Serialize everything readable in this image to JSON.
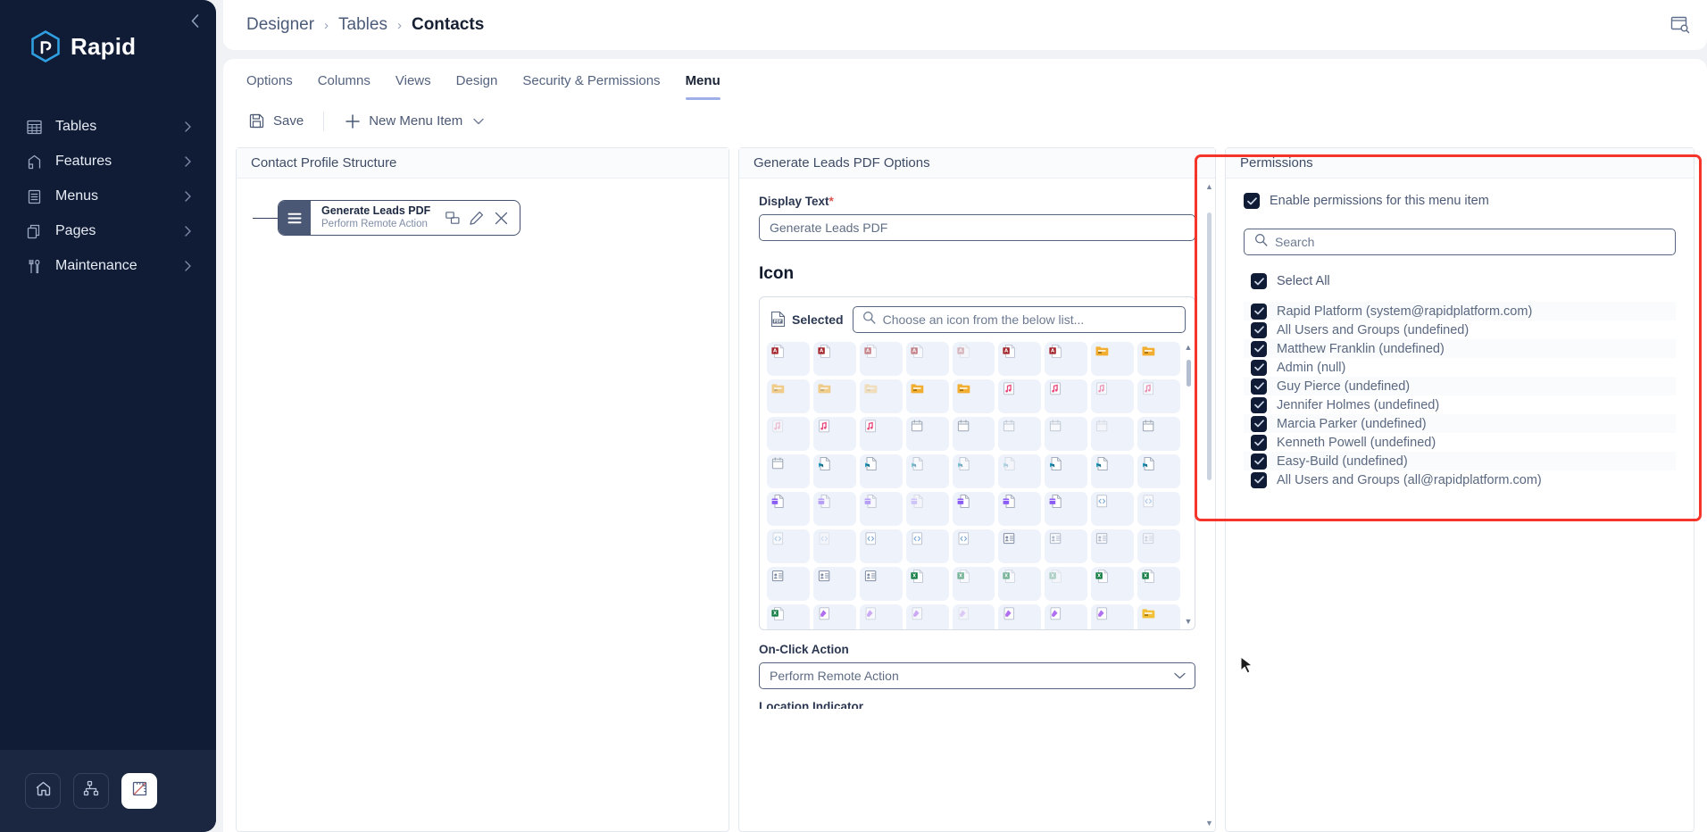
{
  "brand": {
    "name": "Rapid",
    "collapse_icon": "chevron-left-icon"
  },
  "sidebar": {
    "items": [
      {
        "label": "Tables",
        "icon": "table-icon"
      },
      {
        "label": "Features",
        "icon": "features-icon"
      },
      {
        "label": "Menus",
        "icon": "menu-list-icon"
      },
      {
        "label": "Pages",
        "icon": "pages-icon"
      },
      {
        "label": "Maintenance",
        "icon": "tools-icon"
      }
    ],
    "footer_buttons": [
      {
        "name": "home-button",
        "icon": "home-icon",
        "active": false
      },
      {
        "name": "workflow-button",
        "icon": "sitemap-icon",
        "active": false
      },
      {
        "name": "designer-button",
        "icon": "ruler-icon",
        "active": true
      }
    ]
  },
  "topbar": {
    "breadcrumb": [
      {
        "label": "Designer",
        "active": false
      },
      {
        "label": "Tables",
        "active": false
      },
      {
        "label": "Contacts",
        "active": true
      }
    ],
    "separator": "›",
    "right_icon": "window-search-icon"
  },
  "tabs": [
    {
      "label": "Options",
      "active": false
    },
    {
      "label": "Columns",
      "active": false
    },
    {
      "label": "Views",
      "active": false
    },
    {
      "label": "Design",
      "active": false
    },
    {
      "label": "Security & Permissions",
      "active": false
    },
    {
      "label": "Menu",
      "active": true
    }
  ],
  "toolbar": {
    "save_label": "Save",
    "save_icon": "save-disk-icon",
    "new_menu_item_label": "New Menu Item",
    "new_menu_item_icon": "plus-icon",
    "new_menu_item_chevron": "chevron-down-icon"
  },
  "structure": {
    "title": "Contact Profile Structure",
    "card": {
      "title": "Generate Leads PDF",
      "subtitle": "Perform Remote Action",
      "grip_icon": "hamburger-grip-icon",
      "actions": [
        {
          "name": "duplicate-icon",
          "glyph": "copy"
        },
        {
          "name": "edit-pencil-icon",
          "glyph": "pencil"
        },
        {
          "name": "delete-close-icon",
          "glyph": "close"
        }
      ]
    }
  },
  "options": {
    "title": "Generate Leads PDF Options",
    "display_text": {
      "label": "Display Text",
      "required_marker": "*",
      "value": "Generate Leads PDF"
    },
    "icon_section": {
      "title": "Icon",
      "selected_label": "Selected",
      "selected_icon": "pdf-file-icon",
      "search_placeholder": "Choose an icon from the below list...",
      "search_value": "",
      "search_icon": "search-icon",
      "scroll_up_icon": "caret-up-icon",
      "scroll_down_icon": "caret-down-icon",
      "grid_columns": 9,
      "grid_rows": 8,
      "icon_families": [
        {
          "type": "access-db-file",
          "color": "#a4262c",
          "count": 7
        },
        {
          "type": "archive-folder",
          "color": "#f2ae30",
          "count": 7
        },
        {
          "type": "audio-file",
          "color": "#e8467c",
          "count": 7
        },
        {
          "type": "calendar-file",
          "color": "#9aa5b5",
          "count": 7
        },
        {
          "type": "adobe-file",
          "color": "#2aa5c4",
          "count": 8
        },
        {
          "type": "archive-purple-file",
          "color": "#8b5cf6",
          "count": 7
        },
        {
          "type": "code-file",
          "color": "#6b9fd6",
          "count": 7
        },
        {
          "type": "contact-card-file",
          "color": "#7f8ca3",
          "count": 7
        },
        {
          "type": "excel-file",
          "color": "#107c41",
          "count": 7
        },
        {
          "type": "exe-file",
          "color": "#b06ef0",
          "count": 7
        },
        {
          "type": "folder-device",
          "color": "#f2c037",
          "count": 2
        }
      ]
    },
    "on_click_action": {
      "label": "On-Click Action",
      "value": "Perform Remote Action",
      "chevron": "chevron-down-icon"
    },
    "clipped_label": "Location Indicator"
  },
  "permissions": {
    "title": "Permissions",
    "enable": {
      "label": "Enable permissions for this menu item",
      "checked": true
    },
    "search": {
      "placeholder": "Search",
      "value": "",
      "icon": "search-icon"
    },
    "select_all": {
      "label": "Select All",
      "checked": true
    },
    "items": [
      {
        "label": "Rapid Platform (system@rapidplatform.com)",
        "checked": true
      },
      {
        "label": "All Users and Groups (undefined)",
        "checked": true
      },
      {
        "label": "Matthew Franklin (undefined)",
        "checked": true
      },
      {
        "label": "Admin (null)",
        "checked": true
      },
      {
        "label": "Guy Pierce (undefined)",
        "checked": true
      },
      {
        "label": "Jennifer Holmes (undefined)",
        "checked": true
      },
      {
        "label": "Marcia Parker (undefined)",
        "checked": true
      },
      {
        "label": "Kenneth Powell (undefined)",
        "checked": true
      },
      {
        "label": "Easy-Build (undefined)",
        "checked": true
      },
      {
        "label": "All Users and Groups (all@rapidplatform.com)",
        "checked": true
      }
    ],
    "highlight_color": "#f5342a"
  },
  "colors": {
    "sidebar_bg": "#101c36",
    "accent": "#9fb0e8",
    "page_bg": "#f1f2f5",
    "card_accent": "#4a5775"
  }
}
